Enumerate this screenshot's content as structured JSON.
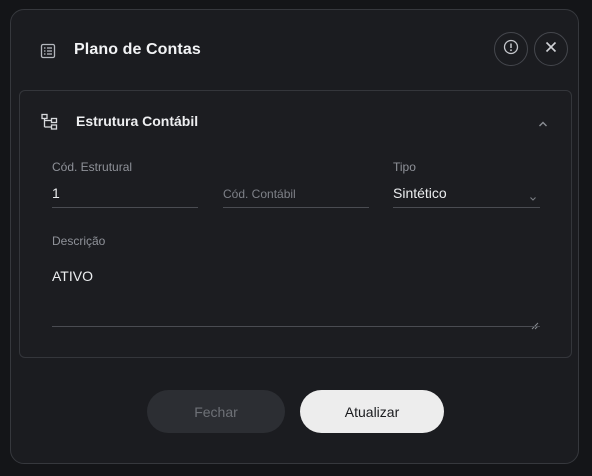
{
  "modal": {
    "title": "Plano de Contas",
    "header_icon": "list-icon",
    "info_icon": "info-icon",
    "close_icon": "close-icon"
  },
  "section": {
    "title": "Estrutura Contábil",
    "icon": "hierarchy-icon",
    "collapse_icon": "chevron-up-icon",
    "fields": {
      "cod_estrutural": {
        "label": "Cód. Estrutural",
        "value": "1"
      },
      "cod_contabil": {
        "placeholder": "Cód. Contábil",
        "value": ""
      },
      "tipo": {
        "label": "Tipo",
        "value": "Sintético"
      },
      "descricao": {
        "label": "Descrição",
        "value": "ATIVO"
      }
    }
  },
  "actions": {
    "fechar_label": "Fechar",
    "atualizar_label": "Atualizar"
  },
  "colors": {
    "background": "#141518",
    "modal_bg": "#1b1c20",
    "border": "#36383d",
    "primary_button_bg": "#ededed",
    "secondary_button_bg": "#2c2e33",
    "secondary_button_text": "#6e7177"
  }
}
